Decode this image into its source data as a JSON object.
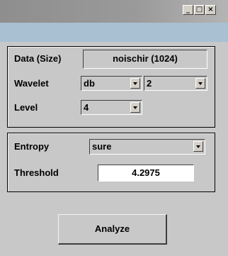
{
  "window": {
    "minimize_label": "_",
    "maximize_label": "□",
    "close_label": "×"
  },
  "data_panel": {
    "data_label": "Data  (Size)",
    "data_value": "noischir  (1024)",
    "wavelet_label": "Wavelet",
    "wavelet_family": "db",
    "wavelet_number": "2",
    "level_label": "Level",
    "level_value": "4"
  },
  "entropy_panel": {
    "entropy_label": "Entropy",
    "entropy_value": "sure",
    "threshold_label": "Threshold",
    "threshold_value": "4.2975"
  },
  "actions": {
    "analyze_label": "Analyze"
  }
}
